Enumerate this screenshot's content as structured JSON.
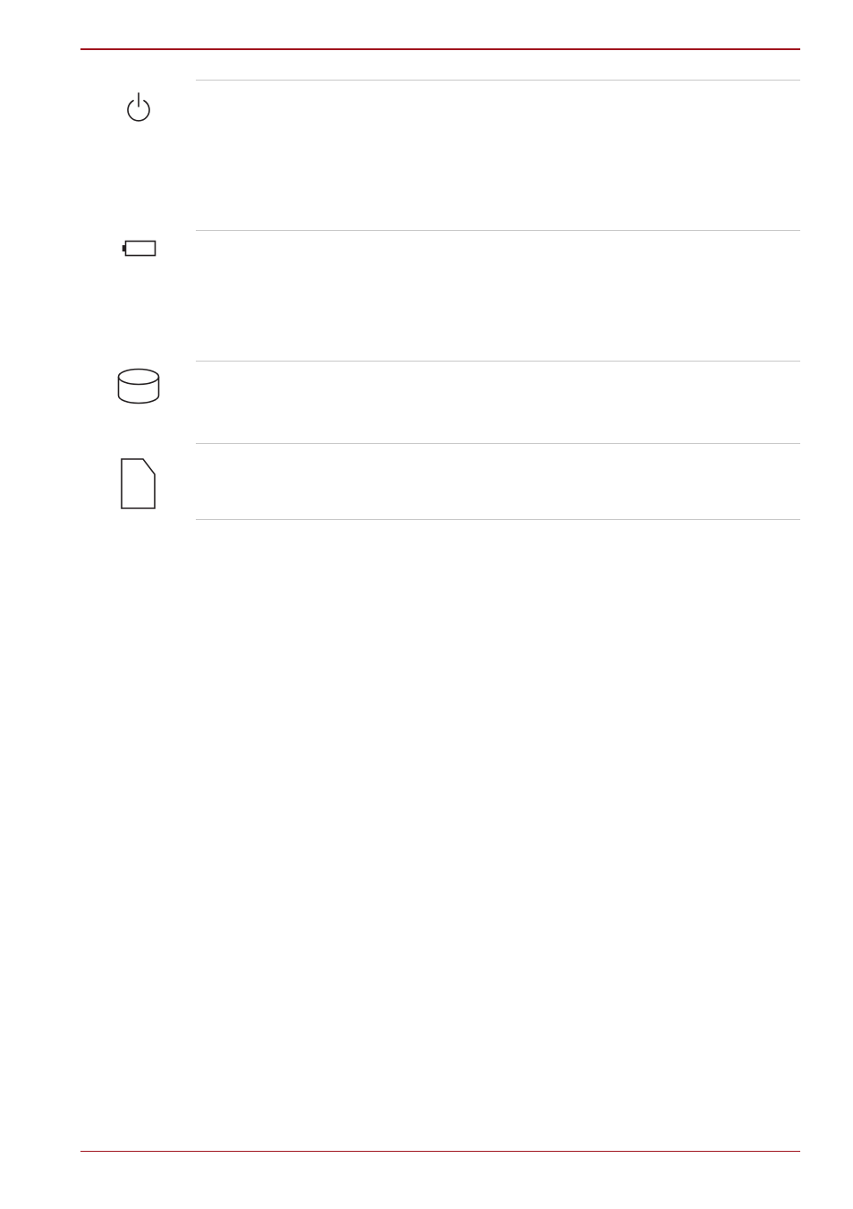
{
  "page": {
    "accent_color": "#a0141e",
    "divider_color": "#c8c8c8",
    "icon_color": "#231f20"
  },
  "indicators": [
    {
      "icon": "power-icon",
      "label": ""
    },
    {
      "icon": "battery-icon",
      "label": ""
    },
    {
      "icon": "hard-disk-icon",
      "label": ""
    },
    {
      "icon": "memory-card-icon",
      "label": ""
    }
  ]
}
